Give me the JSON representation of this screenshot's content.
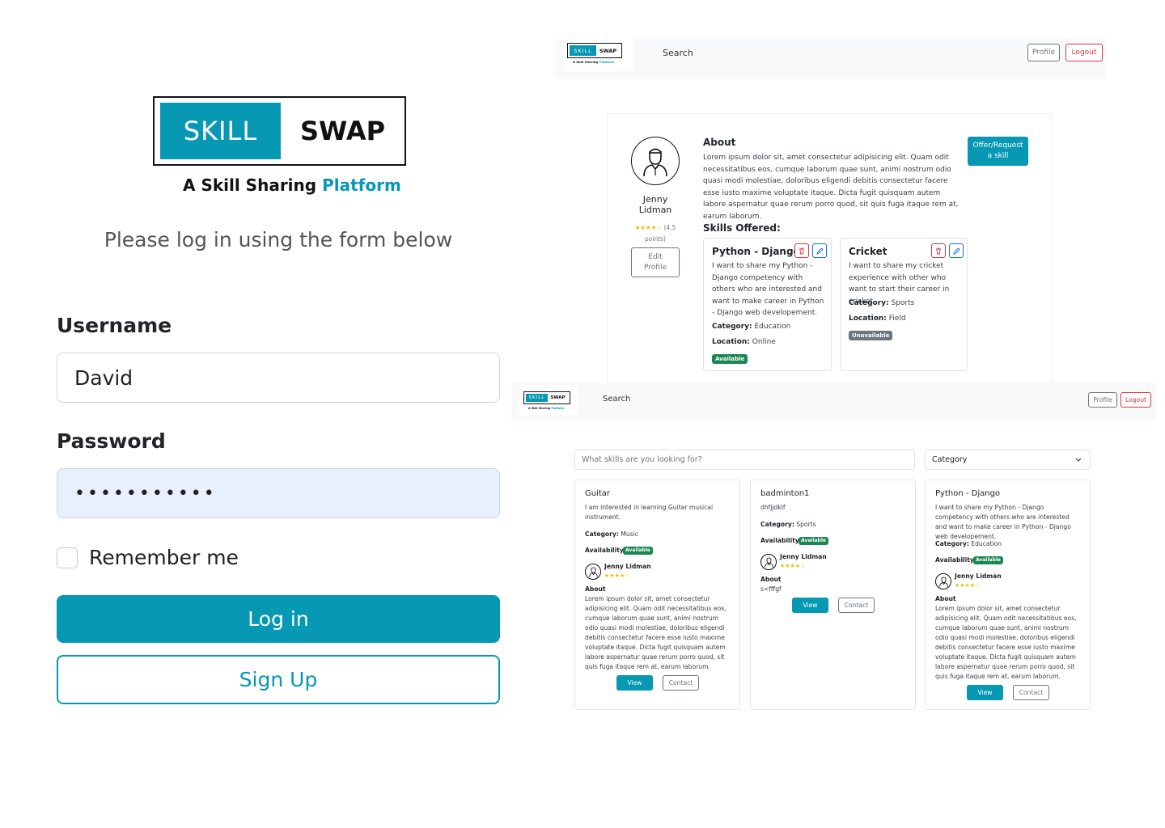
{
  "logo": {
    "skill": "SKILL",
    "swap": "SWAP",
    "tagline_main": "A Skill Sharing ",
    "tagline_highlight": "Platform"
  },
  "login": {
    "prompt": "Please log in using the form below",
    "username_label": "Username",
    "username_value": "David",
    "password_label": "Password",
    "password_value": "•••••••••••",
    "remember_label": "Remember me",
    "login_button": "Log in",
    "signup_button": "Sign Up"
  },
  "navbar": {
    "search": "Search",
    "profile": "Profile",
    "logout": "Logout"
  },
  "profile_page": {
    "name_line1": "Jenny",
    "name_line2": "Lidman",
    "stars": "★★★★☆",
    "points_line1": "(4.5",
    "points_line2": "points)",
    "edit_line1": "Edit",
    "edit_line2": "Profile",
    "about_title": "About",
    "about_text": "Lorem ipsum dolor sit, amet consectetur adipisicing elit. Quam odit necessitatibus eos, cumque laborum quae sunt, animi nostrum odio quasi modi molestiae, doloribus eligendi debitis consectetur facere esse iusto maxime voluptate itaque. Dicta fugit quisquam autem labore aspernatur quae rerum porro quod, sit quis fuga itaque rem at, earum laborum.",
    "offer_line1": "Offer/Request",
    "offer_line2": "a skill",
    "skills_title": "Skills Offered:",
    "skills": [
      {
        "title": "Python - Django",
        "desc": "I want to share my Python - Django competency with others who are interested and want to make career in Python - Django web developement.",
        "category_label": "Category:",
        "category": "Education",
        "location_label": "Location:",
        "location": "Online",
        "status": "Available"
      },
      {
        "title": "Cricket",
        "desc": "I want to share my cricket experience with other who want to start their career in cricket",
        "category_label": "Category:",
        "category": "Sports",
        "location_label": "Location:",
        "location": "Field",
        "status": "Unavailable"
      }
    ]
  },
  "search_page": {
    "placeholder": "What skills are you looking for?",
    "category_select": "Category",
    "results": [
      {
        "title": "Guitar",
        "desc": "I am interested in learning Guitar musical instrument.",
        "category_label": "Category:",
        "category": "Music",
        "availability_label": "Availability:",
        "status": "Available",
        "user": "Jenny Lidman",
        "stars": "★★★★☆",
        "about_label": "About",
        "about": "Lorem ipsum dolor sit, amet consectetur adipisicing elit. Quam odit necessitatibus eos, cumque laborum quae sunt, animi nostrum odio quasi modi molestiae, doloribus eligendi debitis consectetur facere esse iusto maxime voluptate itaque. Dicta fugit quisquam autem labore aspernatur quae rerum porro quod, sit quis fuga itaque rem at, earum laborum.",
        "view": "View",
        "contact": "Contact"
      },
      {
        "title": "badminton1",
        "desc": "dhfjjdklf",
        "category_label": "Category:",
        "category": "Sports",
        "availability_label": "Availability:",
        "status": "Available",
        "user": "Jenny Lidman",
        "stars": "★★★★☆",
        "about_label": "About",
        "about": "s<fffgf",
        "view": "View",
        "contact": "Contact"
      },
      {
        "title": "Python - Django",
        "desc": "I want to share my Python - Django competency with others who are interested and want to make career in Python - Django web developement.",
        "category_label": "Category:",
        "category": "Education",
        "availability_label": "Availability:",
        "status": "Available",
        "user": "Jenny Lidman",
        "stars": "★★★★☆",
        "about_label": "About",
        "about": "Lorem ipsum dolor sit, amet consectetur adipisicing elit. Quam odit necessitatibus eos, cumque laborum quae sunt, animi nostrum odio quasi modi molestiae, doloribus eligendi debitis consectetur facere esse iusto maxime voluptate itaque. Dicta fugit quisquam autem labore aspernatur quae rerum porro quod, sit quis fuga itaque rem at, earum laborum.",
        "view": "View",
        "contact": "Contact"
      }
    ]
  },
  "colors": {
    "brand": "#0798b3",
    "danger": "#dc3545",
    "secondary": "#6c757d",
    "success": "#198754",
    "star": "#f5b800"
  }
}
